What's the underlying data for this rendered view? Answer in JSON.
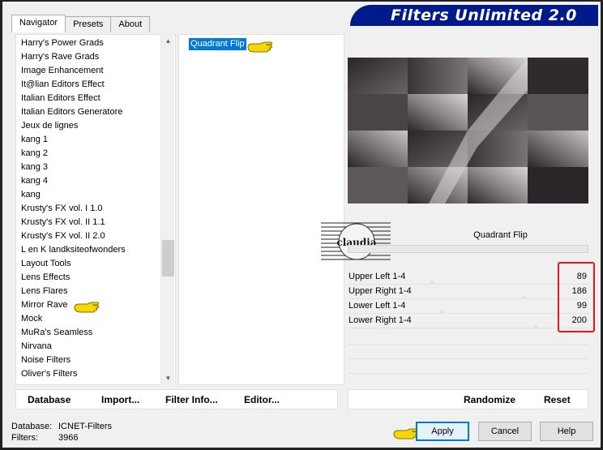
{
  "app": {
    "title": "Filters Unlimited 2.0"
  },
  "tabs": [
    {
      "label": "Navigator",
      "active": true
    },
    {
      "label": "Presets",
      "active": false
    },
    {
      "label": "About",
      "active": false
    }
  ],
  "categories": [
    "Harry's Power Grads",
    "Harry's Rave Grads",
    "Image Enhancement",
    "It@lian Editors Effect",
    "Italian Editors Effect",
    "Italian Editors Generatore",
    "Jeux de lignes",
    "kang 1",
    "kang 2",
    "kang 3",
    "kang 4",
    "kang",
    "Krusty's FX vol. I 1.0",
    "Krusty's FX vol. II 1.1",
    "Krusty's FX vol. II 2.0",
    "L en K landksiteofwonders",
    "Layout Tools",
    "Lens Effects",
    "Lens Flares",
    "Mirror Rave",
    "Mock",
    "MuRa's Seamless",
    "Nirvana",
    "Noise Filters",
    "Oliver's Filters"
  ],
  "selected_category": "Mirror Rave",
  "filters": [
    "Quadrant Flip"
  ],
  "selected_filter": "Quadrant Flip",
  "current_filter_name": "Quadrant Flip",
  "watermark_text": "claudia",
  "parameters": [
    {
      "label": "Upper Left 1-4",
      "value": "89",
      "level": 0.35
    },
    {
      "label": "Upper Right 1-4",
      "value": "186",
      "level": 0.73
    },
    {
      "label": "Lower Left 1-4",
      "value": "99",
      "level": 0.39
    },
    {
      "label": "Lower Right 1-4",
      "value": "200",
      "level": 0.78
    }
  ],
  "bottom_left_buttons": {
    "database": "Database",
    "import": "Import...",
    "filter_info": "Filter Info...",
    "editor": "Editor..."
  },
  "bottom_right_buttons": {
    "randomize": "Randomize",
    "reset": "Reset"
  },
  "status": {
    "database_label": "Database:",
    "database_value": "ICNET-Filters",
    "filters_label": "Filters:",
    "filters_value": "3966"
  },
  "dialog_buttons": {
    "apply": "Apply",
    "cancel": "Cancel",
    "help": "Help"
  },
  "colors": {
    "selection": "#0078d7",
    "banner": "#001a8c",
    "highlight_box": "#e8161b",
    "pointer_hand": "#f5d800"
  }
}
